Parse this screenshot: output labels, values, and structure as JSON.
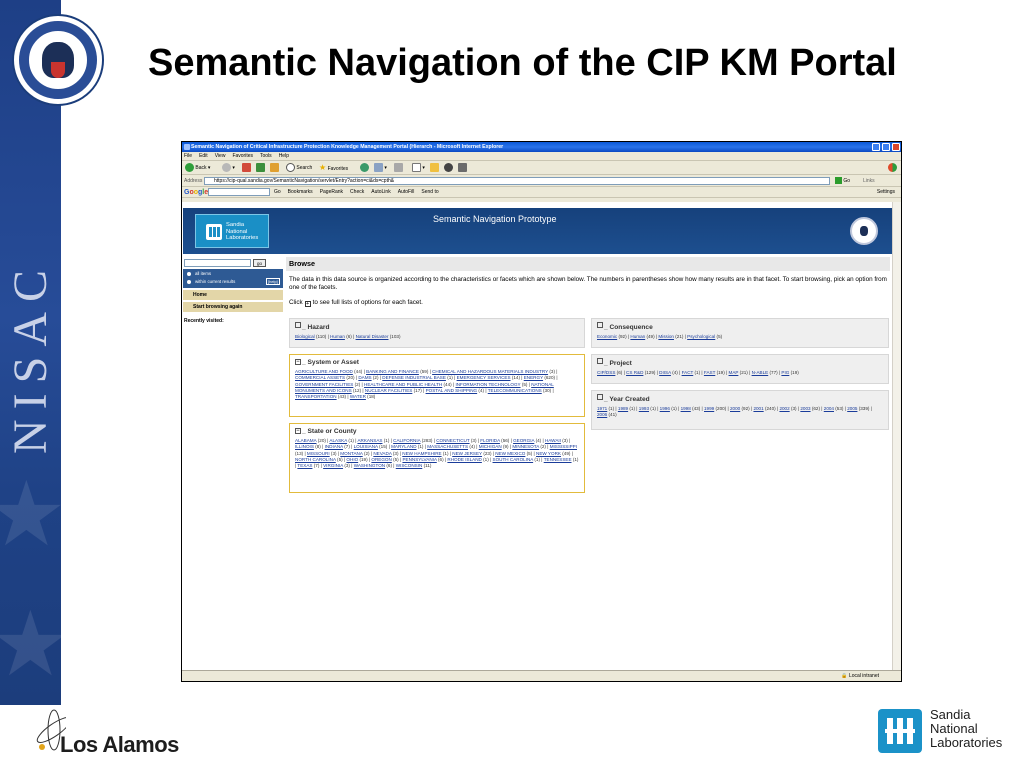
{
  "slide": {
    "title": "Semantic Navigation of the CIP KM Portal",
    "sidebar_vertical_text": "NISAC",
    "footer_left_logo": "Los Alamos",
    "footer_right_logo": [
      "Sandia",
      "National",
      "Laboratories"
    ]
  },
  "browser": {
    "window_title": "Semantic Navigation of Critical Infrastructure Protection Knowledge Management Portal (Hierarch - Microsoft Internet Explorer",
    "menu": [
      "File",
      "Edit",
      "View",
      "Favorites",
      "Tools",
      "Help"
    ],
    "toolbar": {
      "back": "Back",
      "search": "Search",
      "favorites": "Favorites"
    },
    "address_label": "Address",
    "address": "https://cip-qual.sandia.gov/SemanticNavigation/servlet/Entry?action=ci&ds=cpth&",
    "go_label": "Go",
    "links_label": "Links",
    "google_bar": {
      "logo": "Google",
      "items": [
        "Go",
        "Bookmarks",
        "PageRank",
        "Check",
        "AutoLink",
        "AutoFill",
        "Send to"
      ],
      "settings": "Settings"
    },
    "status_zone": "Local intranet"
  },
  "site": {
    "logo_text": [
      "Sandia",
      "National",
      "Laboratories"
    ],
    "header_title": "Semantic Navigation Prototype",
    "sidebar": {
      "go": "go",
      "filter_options": [
        "all items",
        "within current results"
      ],
      "help": "[help]",
      "nav": [
        "Home",
        "Start browsing again"
      ],
      "recently_visited": "Recently visited:"
    },
    "browse": {
      "heading": "Browse",
      "description": "The data in this data source is organized according to the characteristics or facets which are shown below. The numbers in parentheses show how many results are in that facet. To start browsing, pick an option from one of the facets.",
      "click_prefix": "Click",
      "click_suffix": "to see full lists of options for each facet."
    },
    "facets": {
      "hazard": {
        "title": "_ Hazard",
        "items": [
          {
            "name": "Biological",
            "count": "(110)"
          },
          {
            "name": "Human",
            "count": "(6)"
          },
          {
            "name": "Natural Disaster",
            "count": "(103)"
          }
        ]
      },
      "consequence": {
        "title": "_ Consequence",
        "items": [
          {
            "name": "Economic",
            "count": "(92)"
          },
          {
            "name": "Human",
            "count": "(49)"
          },
          {
            "name": "Mission",
            "count": "(21)"
          },
          {
            "name": "Psychological",
            "count": "(5)"
          }
        ]
      },
      "system": {
        "title": "_ System or Asset",
        "items": [
          {
            "name": "AGRICULTURE AND FOOD",
            "count": "(44)"
          },
          {
            "name": "BANKING AND FINANCE",
            "count": "(59)"
          },
          {
            "name": "CHEMICAL AND HAZARDOUS MATERIALS INDUSTRY",
            "count": "(3)"
          },
          {
            "name": "COMMERCIAL ASSETS",
            "count": "(20)"
          },
          {
            "name": "DAMS",
            "count": "(2)"
          },
          {
            "name": "DEFENSE INDUSTRIAL BASE",
            "count": "(1)"
          },
          {
            "name": "EMERGENCY SERVICES",
            "count": "(14)"
          },
          {
            "name": "ENERGY",
            "count": "(620)"
          },
          {
            "name": "GOVERNMENT FACILITIES",
            "count": "(2)"
          },
          {
            "name": "HEALTHCARE AND PUBLIC HEALTH",
            "count": "(44)"
          },
          {
            "name": "INFORMATION TECHNOLOGY",
            "count": "(5)"
          },
          {
            "name": "NATIONAL MONUMENTS AND ICONS",
            "count": "(12)"
          },
          {
            "name": "NUCLEAR FACILITIES",
            "count": "(17)"
          },
          {
            "name": "POSTAL AND SHIPPING",
            "count": "(4)"
          },
          {
            "name": "TELECOMMUNICATIONS",
            "count": "(30)"
          },
          {
            "name": "TRANSPORTATION",
            "count": "(43)"
          },
          {
            "name": "WATER",
            "count": "(18)"
          }
        ]
      },
      "project": {
        "title": "_ Project",
        "items": [
          {
            "name": "CIP/DSS",
            "count": "(6)"
          },
          {
            "name": "CS R&D",
            "count": "(129)"
          },
          {
            "name": "DIISA",
            "count": "(4)"
          },
          {
            "name": "FACT",
            "count": "(1)"
          },
          {
            "name": "FAST",
            "count": "(19)"
          },
          {
            "name": "MAP",
            "count": "(21)"
          },
          {
            "name": "N-ABLE",
            "count": "(77)"
          },
          {
            "name": "PIG",
            "count": "(19)"
          }
        ]
      },
      "year": {
        "title": "_ Year Created",
        "items": [
          {
            "name": "1971",
            "count": "(1)"
          },
          {
            "name": "1989",
            "count": "(1)"
          },
          {
            "name": "1993",
            "count": "(1)"
          },
          {
            "name": "1996",
            "count": "(1)"
          },
          {
            "name": "1998",
            "count": "(43)"
          },
          {
            "name": "1999",
            "count": "(200)"
          },
          {
            "name": "2000",
            "count": "(92)"
          },
          {
            "name": "2001",
            "count": "(240)"
          },
          {
            "name": "2002",
            "count": "(3)"
          },
          {
            "name": "2003",
            "count": "(62)"
          },
          {
            "name": "2004",
            "count": "(53)"
          },
          {
            "name": "2005",
            "count": "(339)"
          },
          {
            "name": "2006",
            "count": "(41)"
          }
        ]
      },
      "state": {
        "title": "_ State or County",
        "items": [
          {
            "name": "ALABAMA",
            "count": "(20)"
          },
          {
            "name": "ALASKA",
            "count": "(1)"
          },
          {
            "name": "ARKANSAS",
            "count": "(1)"
          },
          {
            "name": "CALIFORNIA",
            "count": "(283)"
          },
          {
            "name": "CONNECTICUT",
            "count": "(3)"
          },
          {
            "name": "FLORIDA",
            "count": "(56)"
          },
          {
            "name": "GEORGIA",
            "count": "(4)"
          },
          {
            "name": "HAWAII",
            "count": "(3)"
          },
          {
            "name": "ILLINOIS",
            "count": "(8)"
          },
          {
            "name": "INDIANA",
            "count": "(7)"
          },
          {
            "name": "LOUISIANA",
            "count": "(15)"
          },
          {
            "name": "MARYLAND",
            "count": "(1)"
          },
          {
            "name": "MASSACHUSETTS",
            "count": "(4)"
          },
          {
            "name": "MICHIGAN",
            "count": "(9)"
          },
          {
            "name": "MINNESOTA",
            "count": "(2)"
          },
          {
            "name": "MISSISSIPPI",
            "count": "(13)"
          },
          {
            "name": "MISSOURI",
            "count": "(3)"
          },
          {
            "name": "MONTANA",
            "count": "(2)"
          },
          {
            "name": "NEVADA",
            "count": "(3)"
          },
          {
            "name": "NEW HAMPSHIRE",
            "count": "(1)"
          },
          {
            "name": "NEW JERSEY",
            "count": "(23)"
          },
          {
            "name": "NEW MEXICO",
            "count": "(5)"
          },
          {
            "name": "NEW YORK",
            "count": "(49)"
          },
          {
            "name": "NORTH CAROLINA",
            "count": "(5)"
          },
          {
            "name": "OHIO",
            "count": "(19)"
          },
          {
            "name": "OREGON",
            "count": "(5)"
          },
          {
            "name": "PENNSYLVANIA",
            "count": "(6)"
          },
          {
            "name": "RHODE ISLAND",
            "count": "(1)"
          },
          {
            "name": "SOUTH CAROLINA",
            "count": "(1)"
          },
          {
            "name": "TENNESSEE",
            "count": "(1)"
          },
          {
            "name": "TEXAS",
            "count": "(7)"
          },
          {
            "name": "VIRGINIA",
            "count": "(3)"
          },
          {
            "name": "WASHINGTON",
            "count": "(6)"
          },
          {
            "name": "WISCONSIN",
            "count": "(11)"
          }
        ]
      }
    }
  },
  "colors": {
    "slide_band": "#1f4286",
    "site_header": "#16417c",
    "expanded_facet_border": "#e2bb3c",
    "link": "#1a3c9a"
  }
}
